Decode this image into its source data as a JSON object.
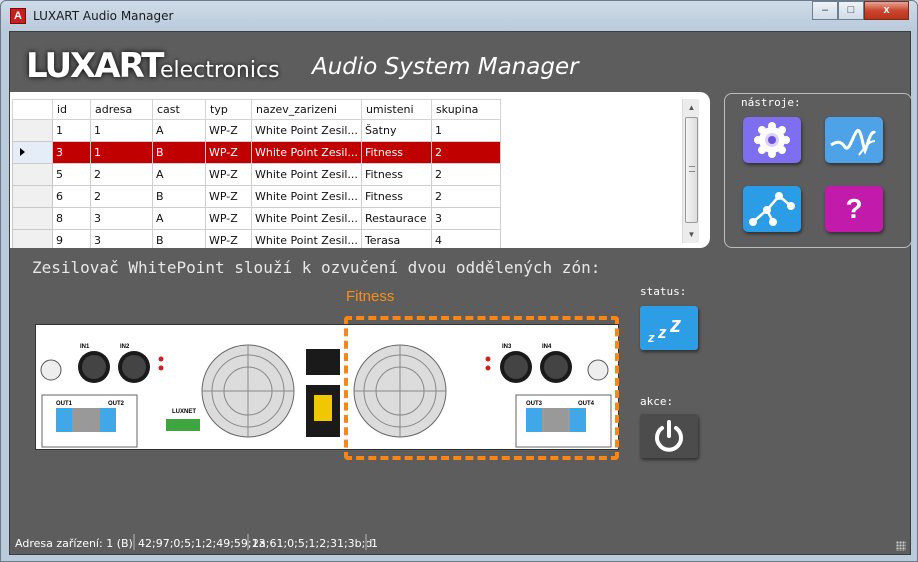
{
  "window": {
    "title": "LUXART Audio Manager",
    "controls": {
      "minimize": "–",
      "maximize": "□",
      "close": "x"
    }
  },
  "header": {
    "logo_main": "LUXART",
    "logo_sub": "electronics",
    "subtitle": "Audio System Manager"
  },
  "table": {
    "columns": [
      "id",
      "adresa",
      "cast",
      "typ",
      "nazev_zarizeni",
      "umisteni",
      "skupina"
    ],
    "rows": [
      {
        "id": "1",
        "adresa": "1",
        "cast": "A",
        "typ": "WP-Z",
        "nazev": "White Point Zesil...",
        "umisteni": "Šatny",
        "skupina": "1"
      },
      {
        "id": "3",
        "adresa": "1",
        "cast": "B",
        "typ": "WP-Z",
        "nazev": "White Point Zesil...",
        "umisteni": "Fitness",
        "skupina": "2"
      },
      {
        "id": "5",
        "adresa": "2",
        "cast": "A",
        "typ": "WP-Z",
        "nazev": "White Point Zesil...",
        "umisteni": "Fitness",
        "skupina": "2"
      },
      {
        "id": "6",
        "adresa": "2",
        "cast": "B",
        "typ": "WP-Z",
        "nazev": "White Point Zesil...",
        "umisteni": "Fitness",
        "skupina": "2"
      },
      {
        "id": "8",
        "adresa": "3",
        "cast": "A",
        "typ": "WP-Z",
        "nazev": "White Point Zesil...",
        "umisteni": "Restaurace",
        "skupina": "3"
      },
      {
        "id": "9",
        "adresa": "3",
        "cast": "B",
        "typ": "WP-Z",
        "nazev": "White Point Zesil...",
        "umisteni": "Terasa",
        "skupina": "4"
      }
    ],
    "selected_row": 1,
    "colors": {
      "selected_bg": "#c00000",
      "selected_fg": "#ffffff"
    }
  },
  "tools": {
    "label": "nástroje:",
    "buttons": [
      {
        "icon": "settings-gear-icon",
        "color": "#7d6ff0"
      },
      {
        "icon": "waveform-signal-icon",
        "color": "#4ea3e8"
      },
      {
        "icon": "network-nodes-icon",
        "color": "#2b9de6"
      },
      {
        "icon": "help-question-icon",
        "color": "#c21bab",
        "glyph": "?"
      }
    ]
  },
  "description": "Zesilovač WhitePoint slouží k ozvučení dvou oddělených zón:",
  "zone": {
    "label": "Fitness",
    "color": "#ff8512"
  },
  "device": {
    "inputs_left": [
      "IN1",
      "IN2"
    ],
    "inputs_right": [
      "IN3",
      "IN4"
    ],
    "outputs_left": [
      "OUT1",
      "OUT2"
    ],
    "outputs_right": [
      "OUT3",
      "OUT4"
    ],
    "network_label": "LUXNET"
  },
  "status": {
    "label": "status:",
    "icon": "sleep-zzz-icon",
    "color": "#2d9ee6"
  },
  "action": {
    "label": "akce:",
    "icon": "power-icon",
    "color": "#4c4c4c"
  },
  "statusbar": {
    "address": "Adresa zařízení: 1 (B)",
    "field1": "42;97;0;5;1;2;49;59;13",
    "field2": "2a;61;0;5;1;2;31;3b;d",
    "field3": "1"
  }
}
